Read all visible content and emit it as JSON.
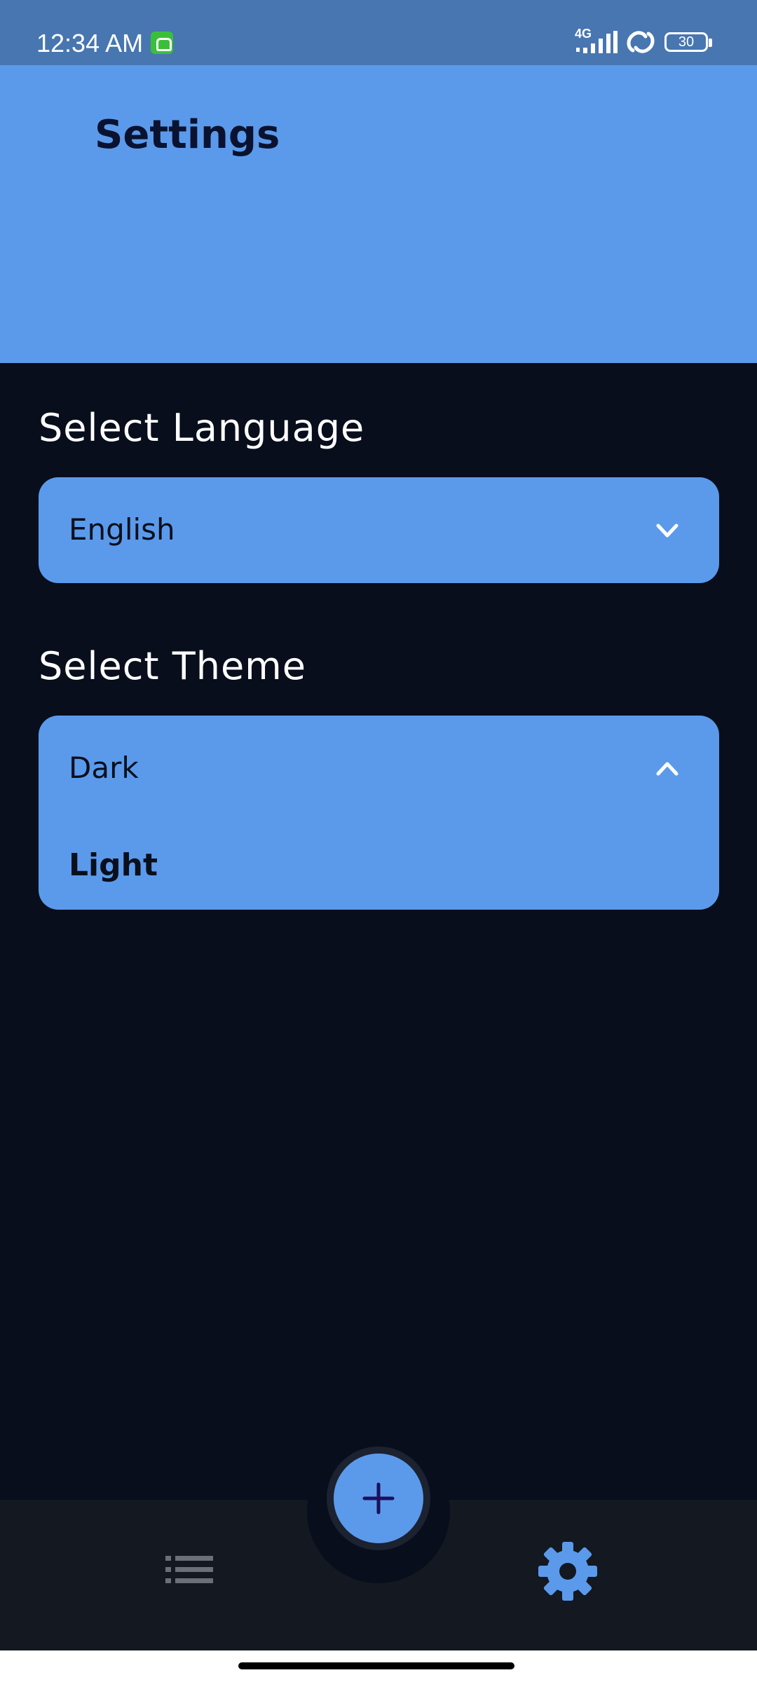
{
  "status_bar": {
    "time": "12:34 AM",
    "network": "4G",
    "battery": "30",
    "icons": [
      "app-notification-icon",
      "signal-icon",
      "link-icon",
      "battery-icon"
    ]
  },
  "header": {
    "title": "Settings"
  },
  "language": {
    "label": "Select Language",
    "selected": "English",
    "expanded": false
  },
  "theme": {
    "label": "Select Theme",
    "selected": "Dark",
    "expanded": true,
    "options": [
      "Light"
    ]
  },
  "bottom_nav": {
    "items": [
      {
        "icon": "list-icon",
        "active": false
      },
      {
        "icon": "add-icon",
        "active": false
      },
      {
        "icon": "gear-icon",
        "active": true
      }
    ]
  },
  "colors": {
    "accent": "#5b9aeb",
    "background": "#080e1c",
    "nav_background": "#141820",
    "status_bar": "#4876b0"
  }
}
